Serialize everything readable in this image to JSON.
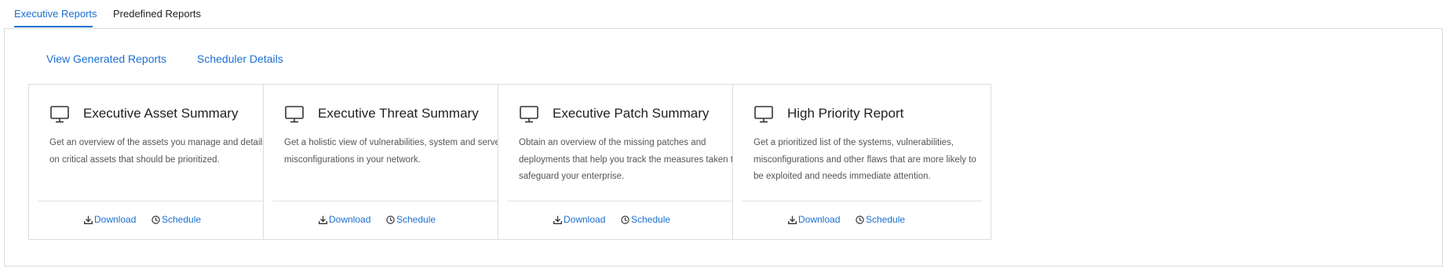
{
  "tabs": [
    {
      "label": "Executive Reports",
      "active": true
    },
    {
      "label": "Predefined Reports",
      "active": false
    }
  ],
  "links": {
    "view_generated": "View Generated Reports",
    "scheduler_details": "Scheduler Details"
  },
  "cards": [
    {
      "icon": "monitor-icon",
      "title": "Executive Asset Summary",
      "description": "Get an overview of the assets you manage and details on critical assets that should be prioritized.",
      "download_label": "Download",
      "schedule_label": "Schedule"
    },
    {
      "icon": "monitor-icon",
      "title": "Executive Threat Summary",
      "description": "Get a holistic view of vulnerabilities, system and server misconfigurations in your network.",
      "download_label": "Download",
      "schedule_label": "Schedule"
    },
    {
      "icon": "monitor-icon",
      "title": "Executive Patch Summary",
      "description": "Obtain an overview of the missing patches and deployments that help you track the measures taken to safeguard your enterprise.",
      "download_label": "Download",
      "schedule_label": "Schedule"
    },
    {
      "icon": "monitor-icon",
      "title": "High Priority Report",
      "description": "Get a prioritized list of the systems, vulnerabilities, misconfigurations and other flaws that are more likely to be exploited and needs immediate attention.",
      "download_label": "Download",
      "schedule_label": "Schedule"
    }
  ],
  "colors": {
    "accent": "#1a6fd0",
    "border": "#dcdcdc",
    "text": "#1f1f1f",
    "muted": "#555555"
  }
}
